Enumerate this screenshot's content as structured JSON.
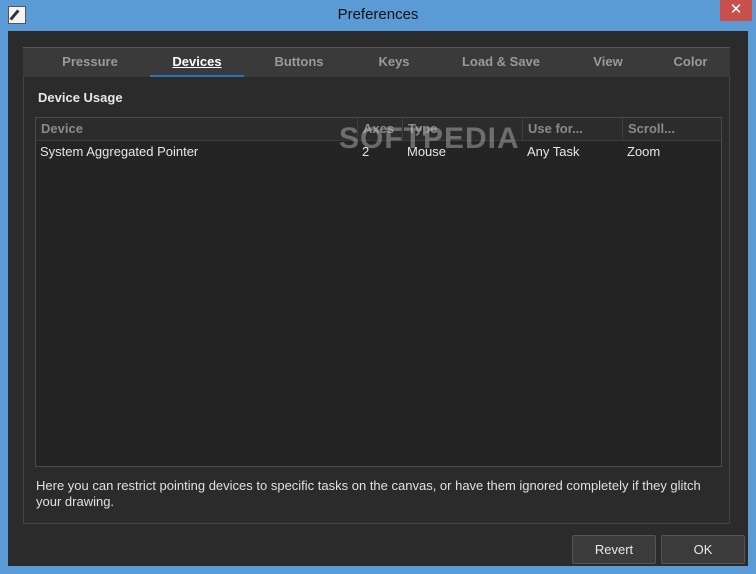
{
  "window": {
    "title": "Preferences",
    "close_label": "✕"
  },
  "tabs": [
    {
      "label": "Pressure",
      "active": false
    },
    {
      "label": "Devices",
      "active": true
    },
    {
      "label": "Buttons",
      "active": false
    },
    {
      "label": "Keys",
      "active": false
    },
    {
      "label": "Load & Save",
      "active": false
    },
    {
      "label": "View",
      "active": false
    },
    {
      "label": "Color",
      "active": false
    }
  ],
  "devices": {
    "section_title": "Device Usage",
    "columns": [
      "Device",
      "Axes",
      "Type",
      "Use for...",
      "Scroll..."
    ],
    "rows": [
      [
        "System Aggregated Pointer",
        "2",
        "Mouse",
        "Any Task",
        "Zoom"
      ]
    ],
    "help_text": "Here you can restrict pointing devices to specific tasks on the canvas, or have them ignored completely if they glitch your drawing."
  },
  "watermark": "SOFTPEDIA",
  "buttons": {
    "revert": "Revert",
    "ok": "OK"
  },
  "colors": {
    "titlebar": "#5b9bd5",
    "active_tab_accent": "#2b72b8",
    "background": "#2b2b2b",
    "close_button": "#c7504a"
  }
}
